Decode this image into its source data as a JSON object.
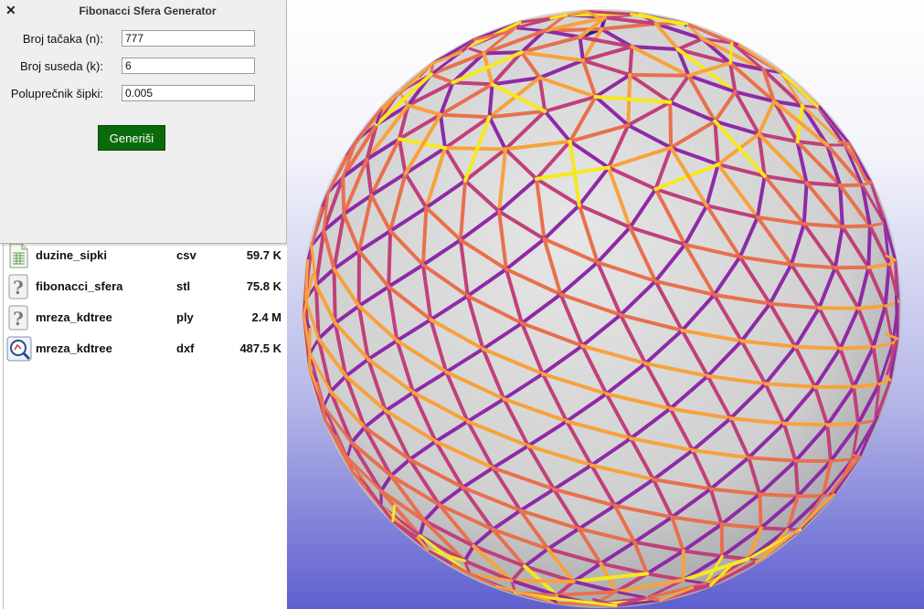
{
  "dialog": {
    "title": "Fibonacci Sfera Generator",
    "close_glyph": "✕",
    "fields": [
      {
        "label": "Broj tačaka (n):",
        "value": "777"
      },
      {
        "label": "Broj suseda (k):",
        "value": "6"
      },
      {
        "label": "Poluprečnik šipki:",
        "value": "0.005"
      }
    ],
    "generate_label": "Generiši",
    "generate_color": "#0a6b0a"
  },
  "files": [
    {
      "name": "duzine_sipki",
      "ext": "csv",
      "size": "59.7 K",
      "icon": "spreadsheet-icon"
    },
    {
      "name": "fibonacci_sfera",
      "ext": "stl",
      "size": "75.8 K",
      "icon": "unknown-file-icon"
    },
    {
      "name": "mreza_kdtree",
      "ext": "ply",
      "size": "2.4 M",
      "icon": "unknown-file-icon"
    },
    {
      "name": "mreza_kdtree",
      "ext": "dxf",
      "size": "487.5 K",
      "icon": "cad-viewer-icon"
    }
  ],
  "viewport": {
    "model": "fibonacci-sphere-mesh",
    "strut_colors": [
      "#2a1c86",
      "#5a1e9e",
      "#8e2aa6",
      "#c0407a",
      "#e8704e",
      "#f7a23c",
      "#f7e81e"
    ],
    "sphere_color": "#d6d6d6",
    "background_bottom": "#5f5fd0"
  }
}
